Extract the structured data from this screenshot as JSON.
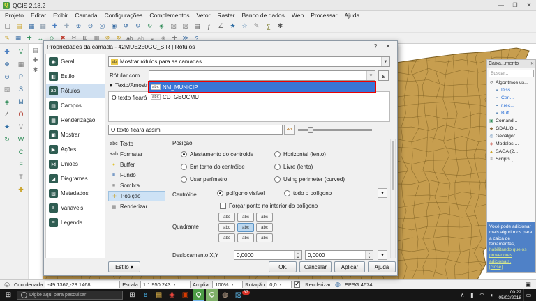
{
  "titlebar": {
    "title": "QGIS 2.18.2",
    "minimize": "—",
    "maximize": "❐",
    "close": "✕"
  },
  "menubar": {
    "items": [
      "Projeto",
      "Editar",
      "Exibir",
      "Camada",
      "Configurações",
      "Complementos",
      "Vetor",
      "Raster",
      "Banco de dados",
      "Web",
      "Processar",
      "Ajuda"
    ]
  },
  "toolbar1": [
    {
      "name": "new-project-icon",
      "glyph": "▢",
      "color": "#666"
    },
    {
      "name": "open-project-icon",
      "glyph": "▤",
      "color": "#c9a227"
    },
    {
      "name": "save-project-icon",
      "glyph": "▦",
      "color": "#3a6ea5"
    },
    {
      "name": "save-as-icon",
      "glyph": "▦",
      "color": "#8899aa"
    },
    {
      "name": "pan-map-icon",
      "glyph": "✚",
      "color": "#4a7ec0"
    },
    {
      "name": "pan-to-selection-icon",
      "glyph": "✚",
      "color": "#99aabb"
    },
    {
      "name": "zoom-in-icon",
      "glyph": "⊕",
      "color": "#3a6ea5"
    },
    {
      "name": "zoom-out-icon",
      "glyph": "⊖",
      "color": "#3a6ea5"
    },
    {
      "name": "zoom-native-icon",
      "glyph": "◎",
      "color": "#3a6ea5"
    },
    {
      "name": "zoom-full-icon",
      "glyph": "◉",
      "color": "#3a6ea5"
    },
    {
      "name": "zoom-last-icon",
      "glyph": "↺",
      "color": "#3a6ea5"
    },
    {
      "name": "zoom-next-icon",
      "glyph": "↻",
      "color": "#3a6ea5"
    },
    {
      "name": "refresh-icon",
      "glyph": "↻",
      "color": "#2e8b57"
    },
    {
      "name": "identify-icon",
      "glyph": "◈",
      "color": "#2e8b57"
    },
    {
      "name": "select-features-icon",
      "glyph": "▧",
      "color": "#888888"
    },
    {
      "name": "deselect-features-icon",
      "glyph": "▨",
      "color": "#888888"
    },
    {
      "name": "attribute-table-icon",
      "glyph": "▤",
      "color": "#555555"
    },
    {
      "name": "field-calculator-icon",
      "glyph": "ƒ",
      "color": "#555555"
    },
    {
      "name": "measure-icon",
      "glyph": "∠",
      "color": "#666666"
    },
    {
      "name": "bookmark-icon",
      "glyph": "★",
      "color": "#2e6da4"
    },
    {
      "name": "new-bookmark-icon",
      "glyph": "☆",
      "color": "#2e6da4"
    },
    {
      "name": "annotation-icon",
      "glyph": "✎",
      "color": "#777777"
    },
    {
      "name": "statistics-icon",
      "glyph": "∑",
      "color": "#7a7a2a"
    },
    {
      "name": "plugins-icon",
      "glyph": "✱",
      "color": "#555555"
    }
  ],
  "toolbar2": [
    {
      "name": "toggle-editing-icon",
      "glyph": "✎",
      "color": "#c9a227"
    },
    {
      "name": "save-edits-icon",
      "glyph": "▦",
      "color": "#3a6ea5"
    },
    {
      "name": "add-feature-icon",
      "glyph": "✚",
      "color": "#2e8b57"
    },
    {
      "name": "move-feature-icon",
      "glyph": "↔",
      "color": "#2e8b57"
    },
    {
      "name": "node-tool-icon",
      "glyph": "◇",
      "color": "#2e8b57"
    },
    {
      "name": "delete-selected-icon",
      "glyph": "✖",
      "color": "#c0392b"
    },
    {
      "name": "cut-features-icon",
      "glyph": "✂",
      "color": "#555555"
    },
    {
      "name": "copy-features-icon",
      "glyph": "⊞",
      "color": "#555555"
    },
    {
      "name": "paste-features-icon",
      "glyph": "▥",
      "color": "#555555"
    },
    {
      "name": "undo-icon",
      "glyph": "↺",
      "color": "#c9a227"
    },
    {
      "name": "redo-icon",
      "glyph": "↻",
      "color": "#c9a227"
    },
    {
      "name": "labeling-icon",
      "glyph": "ab",
      "color": "#333333"
    },
    {
      "name": "layer-labeling-icon",
      "glyph": "ab",
      "color": "#888888"
    },
    {
      "name": "diagram-icon",
      "glyph": "◒",
      "color": "#888888"
    },
    {
      "name": "map-tips-icon",
      "glyph": "◈",
      "color": "#888888"
    },
    {
      "name": "new-shapefile-icon",
      "glyph": "✚",
      "color": "#777777"
    },
    {
      "name": "python-console-icon",
      "glyph": "≫",
      "color": "#3a6ea5"
    },
    {
      "name": "help-icon",
      "glyph": "?",
      "color": "#3a6ea5"
    }
  ],
  "left_toolbar1": [
    {
      "name": "pan-tool-icon",
      "glyph": "✚",
      "color": "#4a7ec0"
    },
    {
      "name": "zoom-in-tool-icon",
      "glyph": "⊕",
      "color": "#3a6ea5"
    },
    {
      "name": "zoom-out-tool-icon",
      "glyph": "⊖",
      "color": "#3a6ea5"
    },
    {
      "name": "select-tool-icon",
      "glyph": "▧",
      "color": "#888888"
    },
    {
      "name": "identify-tool-icon",
      "glyph": "◈",
      "color": "#2e8b57"
    },
    {
      "name": "measure-tool-icon",
      "glyph": "∠",
      "color": "#666666"
    },
    {
      "name": "bookmark-tool-icon",
      "glyph": "★",
      "color": "#2e6da4"
    },
    {
      "name": "refresh-tool-icon",
      "glyph": "↻",
      "color": "#2e8b57"
    }
  ],
  "left_toolbar2": [
    {
      "name": "add-vector-layer-icon",
      "glyph": "V",
      "color": "#2e8b57"
    },
    {
      "name": "add-raster-layer-icon",
      "glyph": "▦",
      "color": "#777777"
    },
    {
      "name": "add-postgis-layer-icon",
      "glyph": "P",
      "color": "#336b9b"
    },
    {
      "name": "add-spatialite-layer-icon",
      "glyph": "S",
      "color": "#336b9b"
    },
    {
      "name": "add-mssql-layer-icon",
      "glyph": "M",
      "color": "#336b9b"
    },
    {
      "name": "add-oracle-layer-icon",
      "glyph": "O",
      "color": "#b03a2e"
    },
    {
      "name": "add-virtual-layer-icon",
      "glyph": "V",
      "color": "#777777"
    },
    {
      "name": "add-wms-layer-icon",
      "glyph": "W",
      "color": "#2e8b57"
    },
    {
      "name": "add-wcs-layer-icon",
      "glyph": "C",
      "color": "#2e8b57"
    },
    {
      "name": "add-wfs-layer-icon",
      "glyph": "F",
      "color": "#2e8b57"
    },
    {
      "name": "add-text-layer-icon",
      "glyph": "T",
      "color": "#777777"
    },
    {
      "name": "new-layer-icon",
      "glyph": "✚",
      "color": "#c9a227"
    }
  ],
  "layers_panel_icons": [
    {
      "name": "layers-toolbar-icon",
      "glyph": "▤",
      "color": "#777777"
    },
    {
      "name": "add-group-icon",
      "glyph": "✚",
      "color": "#777777"
    },
    {
      "name": "layers-settings-icon",
      "glyph": "✱",
      "color": "#777777"
    }
  ],
  "map": {
    "fill": "#c79e4f",
    "stroke": "#7c5f22"
  },
  "dialog": {
    "title": "Propriedades da camada - 42MUE250GC_SIR | Rótulos",
    "help_btn": "?",
    "close_btn": "✕",
    "sidebar": [
      {
        "glyph": "◉",
        "label": "Geral"
      },
      {
        "glyph": "◧",
        "label": "Estilo"
      },
      {
        "glyph": "ab",
        "label": "Rótulos"
      },
      {
        "glyph": "▤",
        "label": "Campos"
      },
      {
        "glyph": "▦",
        "label": "Renderização"
      },
      {
        "glyph": "▣",
        "label": "Mostrar"
      },
      {
        "glyph": "▶",
        "label": "Ações"
      },
      {
        "glyph": "⋈",
        "label": "Uniões"
      },
      {
        "glyph": "◢",
        "label": "Diagramas"
      },
      {
        "glyph": "▨",
        "label": "Metadados"
      },
      {
        "glyph": "ε",
        "label": "Variáveis"
      },
      {
        "glyph": "≡",
        "label": "Legenda"
      }
    ],
    "show_labels": "Mostrar rótulos para as camadas",
    "combo_icon_glyph": "ab",
    "label_with": "Rótular com",
    "expression_btn": "ε",
    "collapse_arrow": "▼",
    "sample_header": "Texto/Amostra",
    "fields": [
      {
        "icon": "abc",
        "name": "NM_MUNICIP"
      },
      {
        "icon": "abc",
        "name": "CD_GEOCMU"
      }
    ],
    "preview_text": "O texto ficará assim",
    "undo_glyph": "↶",
    "tabs": [
      {
        "glyph": "abc",
        "label": "Texto"
      },
      {
        "glyph": "+ab",
        "label": "Formatar"
      },
      {
        "glyph": "●",
        "label": "Buffer"
      },
      {
        "glyph": "■",
        "label": "Fundo"
      },
      {
        "glyph": "■",
        "label": "Sombra"
      },
      {
        "glyph": "✚",
        "label": "Posição"
      },
      {
        "glyph": "▦",
        "label": "Renderizar"
      }
    ],
    "position": {
      "heading": "Posição",
      "col1": [
        "Afastamento do centroide",
        "Em torno do centróide",
        "Usar perímetro"
      ],
      "col2": [
        "Horizontal (lento)",
        "Livre (lento)",
        "Using perimeter (curved)"
      ],
      "centroid_label": "Centróide",
      "centroid_opts": [
        "polígono visível",
        "todo o polígono"
      ],
      "force_point": "Forçar ponto no interior do polígono",
      "quadrant_label": "Quadrante",
      "quadrant_btn": "abc",
      "offset_label": "Deslocamento X,Y",
      "offset_x": "0,0000",
      "offset_y": "0,0000",
      "dd_glyph": "▾"
    },
    "buttons": {
      "estilo": "Estilo",
      "ok": "OK",
      "cancel": "Cancelar",
      "apply": "Aplicar",
      "help": "Ajuda"
    }
  },
  "toolbox": {
    "title": "Caixa...mento",
    "close": "✕",
    "search": "Buscar...",
    "items": [
      {
        "glyph": "↺",
        "label": "Algoritmos us..."
      },
      {
        "glyph": "▪",
        "label": "Diss..."
      },
      {
        "glyph": "▪",
        "label": "Cen..."
      },
      {
        "glyph": "▪",
        "label": "r.rec..."
      },
      {
        "glyph": "▪",
        "label": "Buff..."
      },
      {
        "glyph": "▣",
        "label": "Comand..."
      },
      {
        "glyph": "◆",
        "label": "GDAL/O..."
      },
      {
        "glyph": "◎",
        "label": "Geoalgor..."
      },
      {
        "glyph": "◈",
        "label": "Modelos ..."
      },
      {
        "glyph": "▲",
        "label": "SAGA (2..."
      },
      {
        "glyph": "≡",
        "label": "Scripts [..."
      }
    ],
    "help_text": "Você pode adicionar mais algoritmos para a caixa de ferramentas,",
    "help_link1": "habilitando que os provedores adicionais.",
    "help_link2": "[close]"
  },
  "statusbar": {
    "coordinate_label": "Coordenada",
    "coordinate": "-49.1367,-28.1468",
    "scale_label": "Escala",
    "scale": "1:1.950.243",
    "magnifier_label": "Ampliar",
    "magnifier": "100%",
    "rotation_label": "Rotação",
    "rotation": "0,0",
    "render_label": "Renderizar",
    "epsg": "EPSG:4674"
  },
  "taskbar": {
    "search_placeholder": "Digite aqui para pesquisar",
    "badge": "37",
    "time": "00:22",
    "date": "05/02/2018",
    "icons": [
      {
        "name": "task-view-icon",
        "glyph": "⊞",
        "color": "#dddddd"
      },
      {
        "name": "edge-icon",
        "glyph": "e",
        "color": "#4cc2ff"
      },
      {
        "name": "file-explorer-icon",
        "glyph": "▤",
        "color": "#f3c14b"
      },
      {
        "name": "chrome-icon",
        "glyph": "◉",
        "color": "#e8453c"
      },
      {
        "name": "office-icon",
        "glyph": "▣",
        "color": "#d83b01"
      },
      {
        "name": "qgis-icon",
        "glyph": "Q",
        "color": "#ffffff",
        "bg": "#4c9b45",
        "active": true
      },
      {
        "name": "qgis-browser-icon",
        "glyph": "Q",
        "color": "#ffffff",
        "bg": "#7fb069"
      },
      {
        "name": "gimp-icon",
        "glyph": "◍",
        "color": "#b9a089"
      },
      {
        "name": "photos-icon",
        "glyph": "▨",
        "color": "#5bb4e5"
      }
    ],
    "tray_icons": [
      {
        "name": "tray-chevron-up-icon",
        "glyph": "∧",
        "color": "#dddddd"
      },
      {
        "name": "battery-icon",
        "glyph": "▮",
        "color": "#dddddd"
      },
      {
        "name": "wifi-icon",
        "glyph": "◠",
        "color": "#dddddd"
      },
      {
        "name": "volume-icon",
        "glyph": "◖",
        "color": "#dddddd"
      }
    ]
  }
}
